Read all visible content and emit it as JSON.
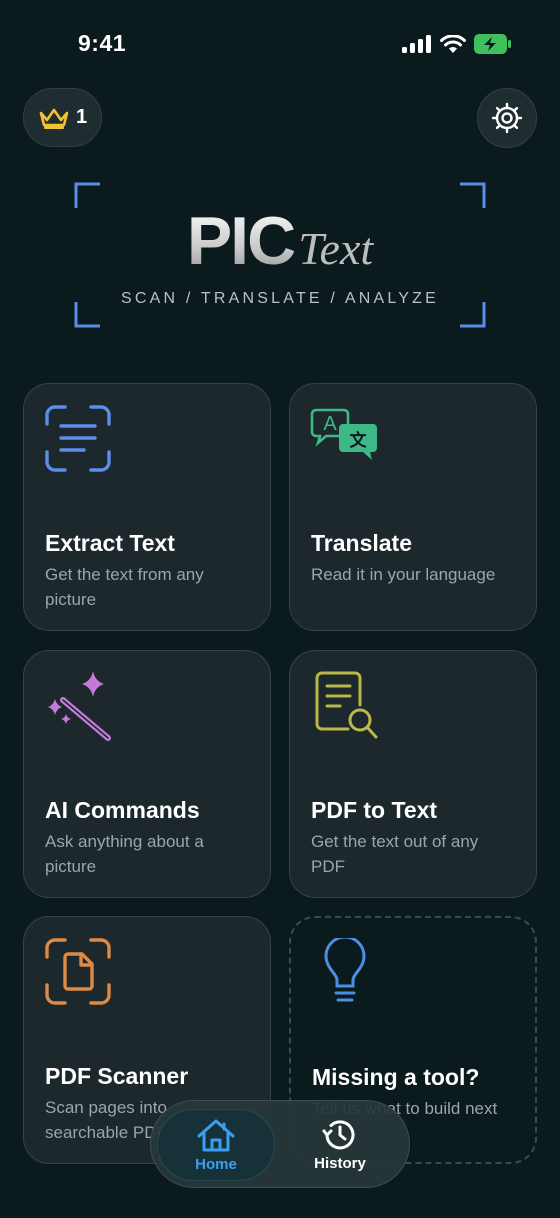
{
  "status_bar": {
    "time": "9:41"
  },
  "header": {
    "premium_count": "1"
  },
  "logo": {
    "word1": "PIC",
    "word2": "Text",
    "tagline": "SCAN / TRANSLATE / ANALYZE"
  },
  "tools": [
    {
      "title": "Extract Text",
      "description": "Get the text from any picture",
      "icon": "scan-text-icon",
      "color": "#5b8ee8"
    },
    {
      "title": "Translate",
      "description": "Read it in your language",
      "icon": "translate-icon",
      "color": "#3fb888"
    },
    {
      "title": "AI Commands",
      "description": "Ask anything about a picture",
      "icon": "magic-wand-icon",
      "color": "#c47ad9"
    },
    {
      "title": "PDF to Text",
      "description": "Get the text out of any PDF",
      "icon": "document-search-icon",
      "color": "#b9b84a"
    },
    {
      "title": "PDF Scanner",
      "description": "Scan pages into searchable PDFs",
      "icon": "scan-document-icon",
      "color": "#dd8a46"
    },
    {
      "title": "Missing a tool?",
      "description": "Tell us what to build next",
      "icon": "lightbulb-icon",
      "color": "#4c8ee6"
    }
  ],
  "tab_bar": {
    "home": {
      "label": "Home",
      "icon": "house-icon"
    },
    "history": {
      "label": "History",
      "icon": "clock-history-icon"
    }
  },
  "colors": {
    "background": "#0b1a1d",
    "card": "#1c282c",
    "accent": "#3a9ff0",
    "battery": "#3ec05c",
    "crown": "#f2c230"
  }
}
